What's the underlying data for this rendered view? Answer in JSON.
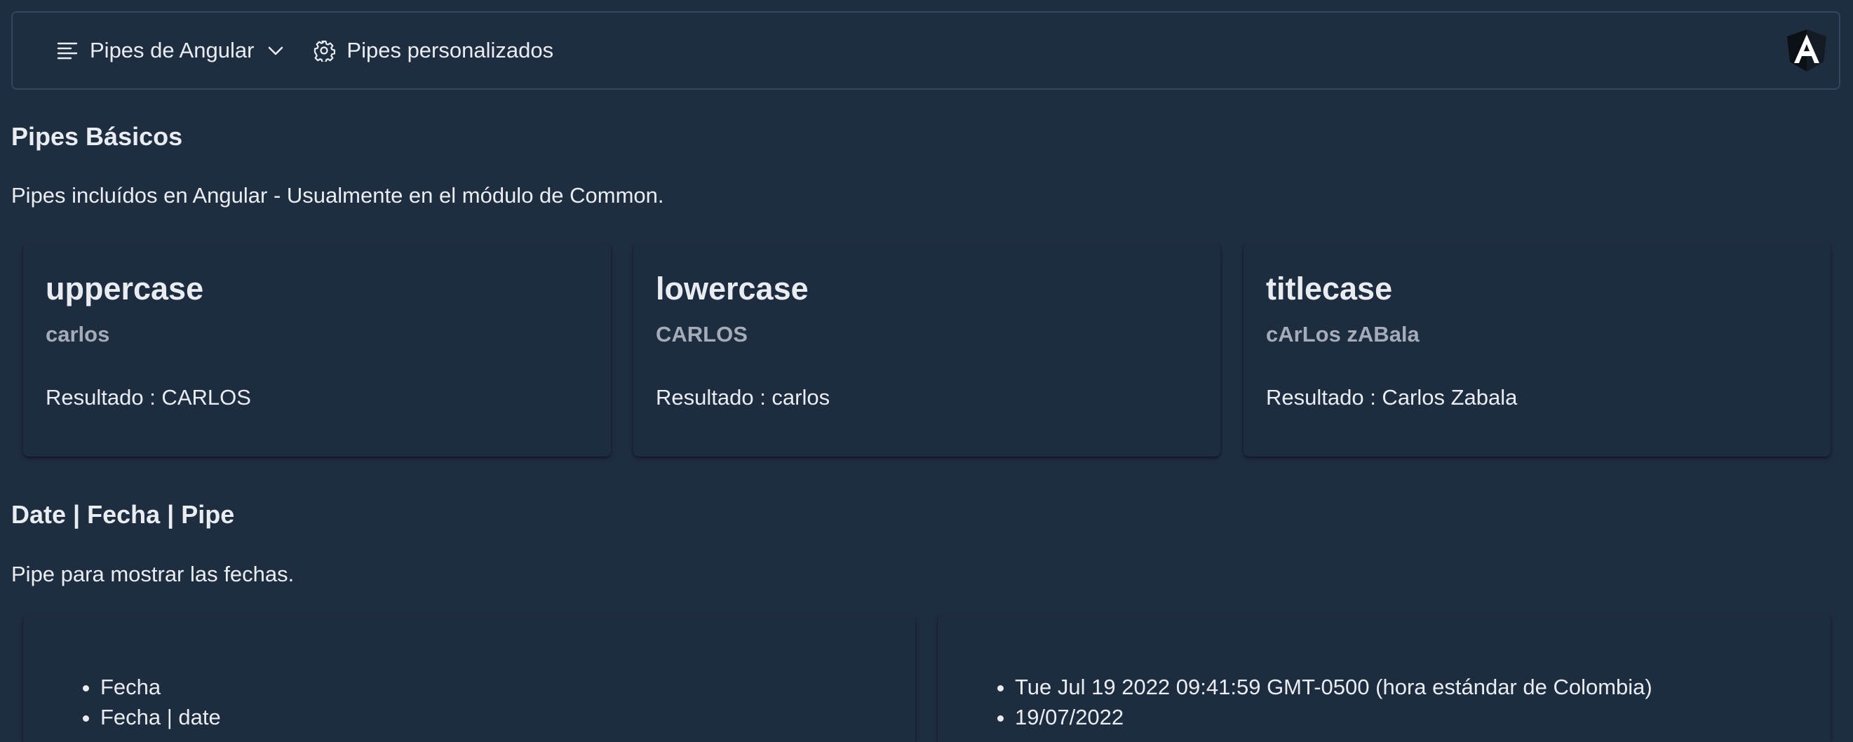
{
  "menubar": {
    "items": [
      {
        "label": "Pipes de Angular",
        "icon": "bars-icon",
        "has_dropdown": true
      },
      {
        "label": "Pipes personalizados",
        "icon": "gear-icon",
        "has_dropdown": false
      }
    ],
    "logo": "angular-logo"
  },
  "basics": {
    "title": "Pipes Básicos",
    "description": "Pipes incluídos en Angular - Usualmente en el módulo de Common.",
    "cards": [
      {
        "title": "uppercase",
        "input": "carlos",
        "result": "Resultado : CARLOS"
      },
      {
        "title": "lowercase",
        "input": "CARLOS",
        "result": "Resultado : carlos"
      },
      {
        "title": "titlecase",
        "input": "cArLos zABala",
        "result": "Resultado : Carlos Zabala"
      }
    ]
  },
  "dates": {
    "title": "Date | Fecha | Pipe",
    "description": "Pipe para mostrar las fechas.",
    "left_items": [
      "Fecha",
      "Fecha | date"
    ],
    "right_items": [
      "Tue Jul 19 2022 09:41:59 GMT-0500 (hora estándar de Colombia)",
      "19/07/2022"
    ]
  },
  "colors": {
    "background": "#1f2d41",
    "card": "#1e2c40",
    "text": "#e9edf2",
    "muted": "#a3acb8",
    "border": "#34455e"
  }
}
